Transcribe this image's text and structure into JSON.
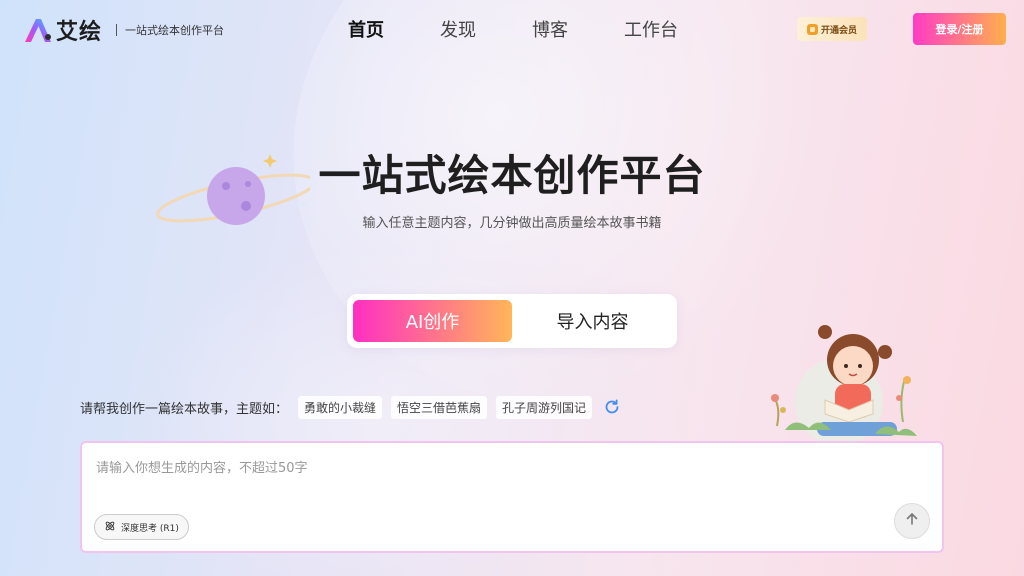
{
  "header": {
    "brand": "艾绘",
    "slogan": "一站式绘本创作平台",
    "nav": [
      "首页",
      "发现",
      "博客",
      "工作台"
    ],
    "active_nav": 0,
    "vip_label": "开通会员",
    "login_label": "登录/注册"
  },
  "hero": {
    "title": "一站式绘本创作平台",
    "subtitle": "输入任意主题内容，几分钟做出高质量绘本故事书籍"
  },
  "mode_switch": {
    "tabs": [
      "AI创作",
      "导入内容"
    ],
    "active": 0
  },
  "topics": {
    "label": "请帮我创作一篇绘本故事，主题如：",
    "chips": [
      "勇敢的小裁缝",
      "悟空三借芭蕉扇",
      "孔子周游列国记"
    ]
  },
  "prompt": {
    "placeholder": "请输入你想生成的内容，不超过50字",
    "value": "",
    "deep_think_label": "深度思考 (R1)"
  },
  "colors": {
    "accent_start": "#ff2fc2",
    "accent_end": "#ffb658",
    "input_border": "#f1c4ef"
  },
  "icons": {
    "refresh": "refresh-icon",
    "send": "arrow-up-icon",
    "deep_think": "atom-icon",
    "vip": "crown-icon"
  }
}
